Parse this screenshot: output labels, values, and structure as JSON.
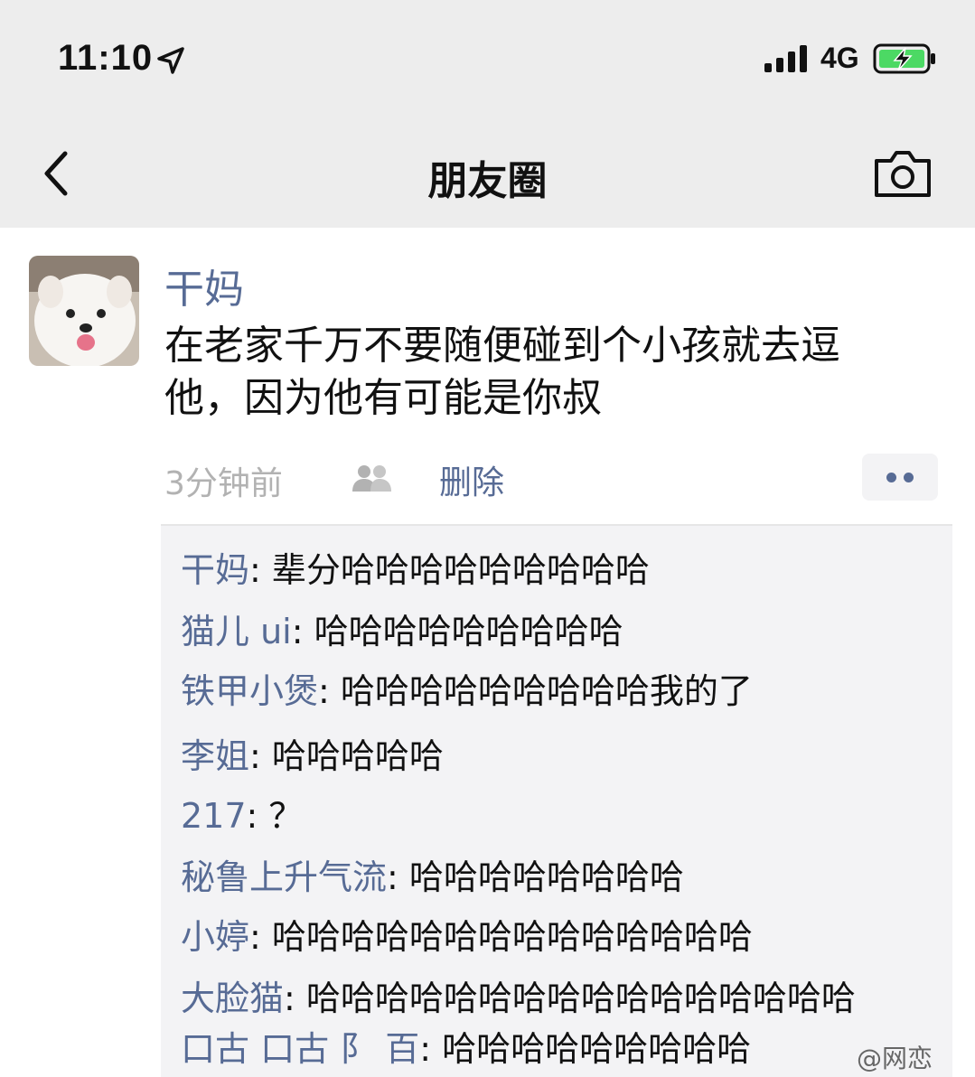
{
  "status_bar": {
    "time": "11:10",
    "network": "4G",
    "battery_color": "#4cd964"
  },
  "nav": {
    "title": "朋友圈",
    "back_icon": "chevron-left-icon",
    "camera_icon": "camera-icon"
  },
  "post": {
    "author": "干妈",
    "text": "在老家千万不要随便碰到个小孩就去逗他，因为他有可能是你叔",
    "time": "3分钟前",
    "delete_label": "删除",
    "name_color": "#576b95"
  },
  "comments": [
    {
      "name": "干妈",
      "text": "辈分哈哈哈哈哈哈哈哈哈"
    },
    {
      "name": "猫儿 ui",
      "text": "哈哈哈哈哈哈哈哈哈"
    },
    {
      "name": "铁甲小煲",
      "text": "哈哈哈哈哈哈哈哈哈我的了"
    },
    {
      "name": "李姐",
      "text": "哈哈哈哈哈"
    },
    {
      "name": "217",
      "text": "？"
    },
    {
      "name": "秘鲁上升气流",
      "text": "哈哈哈哈哈哈哈哈"
    },
    {
      "name": "小婷",
      "text": "哈哈哈哈哈哈哈哈哈哈哈哈哈哈"
    },
    {
      "name": "大脸猫",
      "text": "哈哈哈哈哈哈哈哈哈哈哈哈哈哈哈哈"
    },
    {
      "name": "口古 口古 阝 百",
      "text": "哈哈哈哈哈哈哈哈哈"
    }
  ],
  "watermark": "@网恋"
}
